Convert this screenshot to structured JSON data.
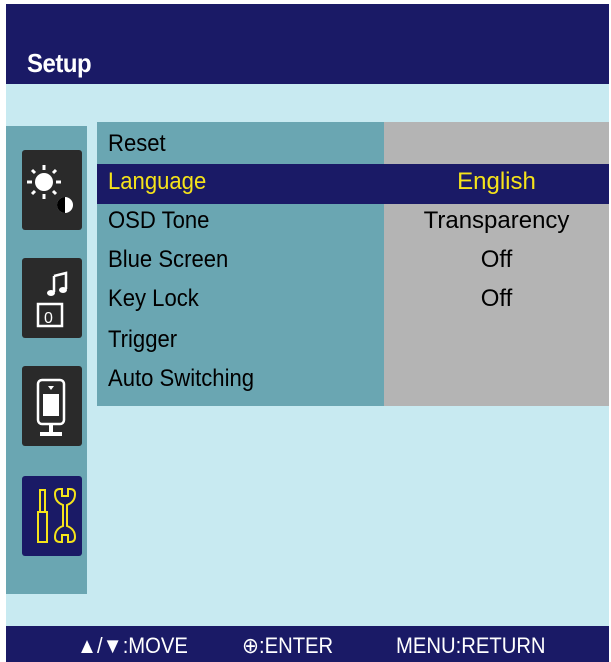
{
  "header": {
    "title": "Setup"
  },
  "sidebar": {
    "items": [
      {
        "icon": "brightness-contrast-icon",
        "active": false
      },
      {
        "icon": "audio-icon",
        "active": false
      },
      {
        "icon": "display-icon",
        "active": false
      },
      {
        "icon": "tools-icon",
        "active": true
      }
    ]
  },
  "menu": {
    "rows": [
      {
        "label": "Reset",
        "value": ""
      },
      {
        "label": "Language",
        "value": "English",
        "selected": true
      },
      {
        "label": "OSD Tone",
        "value": "Transparency"
      },
      {
        "label": "Blue Screen",
        "value": "Off"
      },
      {
        "label": "Key Lock",
        "value": "Off"
      },
      {
        "label": "Trigger",
        "value": ""
      },
      {
        "label": "Auto Switching",
        "value": ""
      }
    ]
  },
  "footer": {
    "move": "▲/▼:MOVE",
    "enter": "⊕:ENTER",
    "return": "MENU:RETURN"
  },
  "colors": {
    "header_bg": "#1a1a66",
    "background": "#c8eaf1",
    "label_panel": "#6aa6b2",
    "value_panel": "#b4b4b4",
    "selected_text": "#f5e31a"
  }
}
